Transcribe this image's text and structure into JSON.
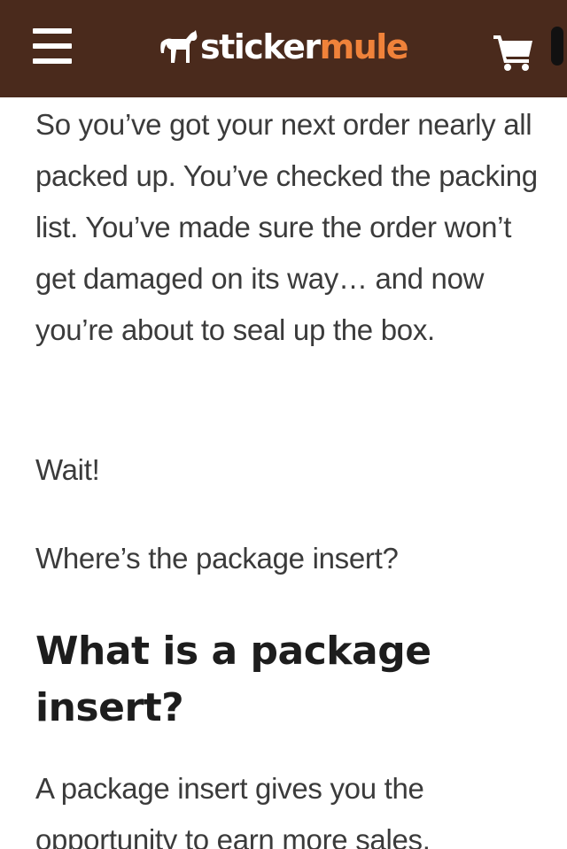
{
  "header": {
    "brand_part1": "sticker",
    "brand_part2": "mule",
    "menu_icon": "hamburger-menu-icon",
    "cart_icon": "shopping-cart-icon",
    "background_color": "#4a2a1c",
    "brand_accent_color": "#f0823a"
  },
  "article": {
    "intro_paragraph": "So you’ve got your next order nearly all packed up. You’ve checked the packing list. You’ve made sure the order won’t get damaged on its way… and now you’re about to seal up the box.",
    "wait_paragraph": "Wait!",
    "question_paragraph": "Where’s the package insert?",
    "heading": "What is a package insert?",
    "next_paragraph": "A package insert gives you the opportunity to earn more sales."
  }
}
